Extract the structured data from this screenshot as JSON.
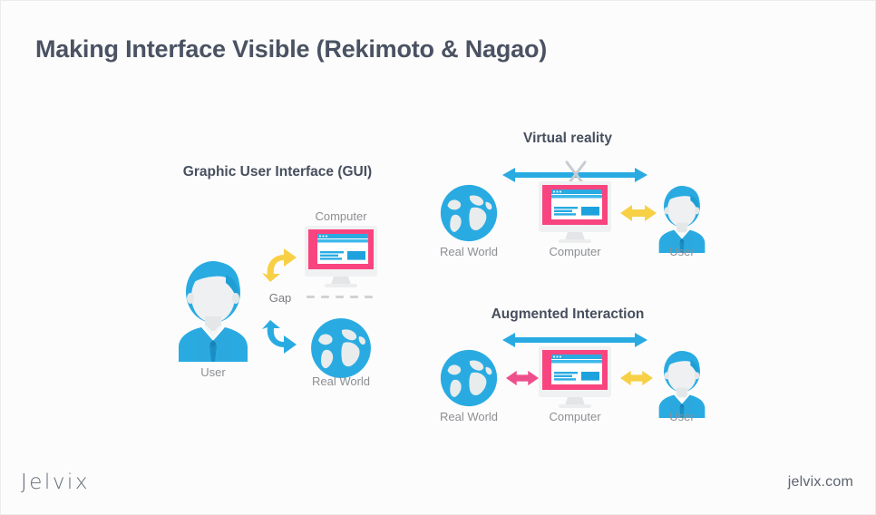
{
  "slide": {
    "title": "Making Interface Visible (Rekimoto & Nagao)",
    "background_color": "#fcfcfc",
    "title_color": "#4a5263"
  },
  "palette": {
    "blue": "#29abe2",
    "blue_dark": "#1b9fd8",
    "yellow": "#f7d046",
    "pink": "#ef4e8c",
    "magenta": "#f9457f",
    "gray_label": "#8d8f93",
    "gray_dash": "#d2d2d2",
    "heading": "#474f5e"
  },
  "panels": [
    {
      "id": "gui",
      "heading": "Graphic User Interface (GUI)",
      "nodes": [
        {
          "id": "user",
          "label": "User",
          "icon": "person-icon"
        },
        {
          "id": "computer",
          "label": "Computer",
          "icon": "monitor-icon"
        },
        {
          "id": "real_world",
          "label": "Real World",
          "icon": "globe-icon"
        }
      ],
      "gap_label": "Gap",
      "connectors": [
        {
          "id": "user-computer",
          "style": "curved-double",
          "color": "#f7d046",
          "crossed": false
        },
        {
          "id": "user-realworld",
          "style": "curved-double",
          "color": "#29abe2",
          "crossed": false
        }
      ],
      "divider": {
        "type": "dashed",
        "segments": 5,
        "color": "#d2d2d2"
      }
    },
    {
      "id": "virtual_reality",
      "heading": "Virtual reality",
      "nodes": [
        {
          "id": "real_world",
          "label": "Real World",
          "icon": "globe-icon"
        },
        {
          "id": "computer",
          "label": "Computer",
          "icon": "monitor-icon"
        },
        {
          "id": "user",
          "label": "User",
          "icon": "person-icon"
        }
      ],
      "connectors": [
        {
          "id": "realworld-user-span",
          "style": "straight-double",
          "color": "#29abe2",
          "crossed": true
        },
        {
          "id": "computer-user",
          "style": "straight-double",
          "color": "#f7d046",
          "crossed": false
        }
      ]
    },
    {
      "id": "augmented_interaction",
      "heading": "Augmented Interaction",
      "nodes": [
        {
          "id": "real_world",
          "label": "Real World",
          "icon": "globe-icon"
        },
        {
          "id": "computer",
          "label": "Computer",
          "icon": "monitor-icon"
        },
        {
          "id": "user",
          "label": "User",
          "icon": "person-icon"
        }
      ],
      "connectors": [
        {
          "id": "realworld-user-span",
          "style": "straight-double",
          "color": "#29abe2",
          "crossed": false
        },
        {
          "id": "realworld-computer",
          "style": "straight-double",
          "color": "#ef4e8c",
          "crossed": false
        },
        {
          "id": "computer-user",
          "style": "straight-double",
          "color": "#f7d046",
          "crossed": false
        }
      ]
    }
  ],
  "footer": {
    "logo": "Jelvix",
    "url": "jelvix.com"
  }
}
